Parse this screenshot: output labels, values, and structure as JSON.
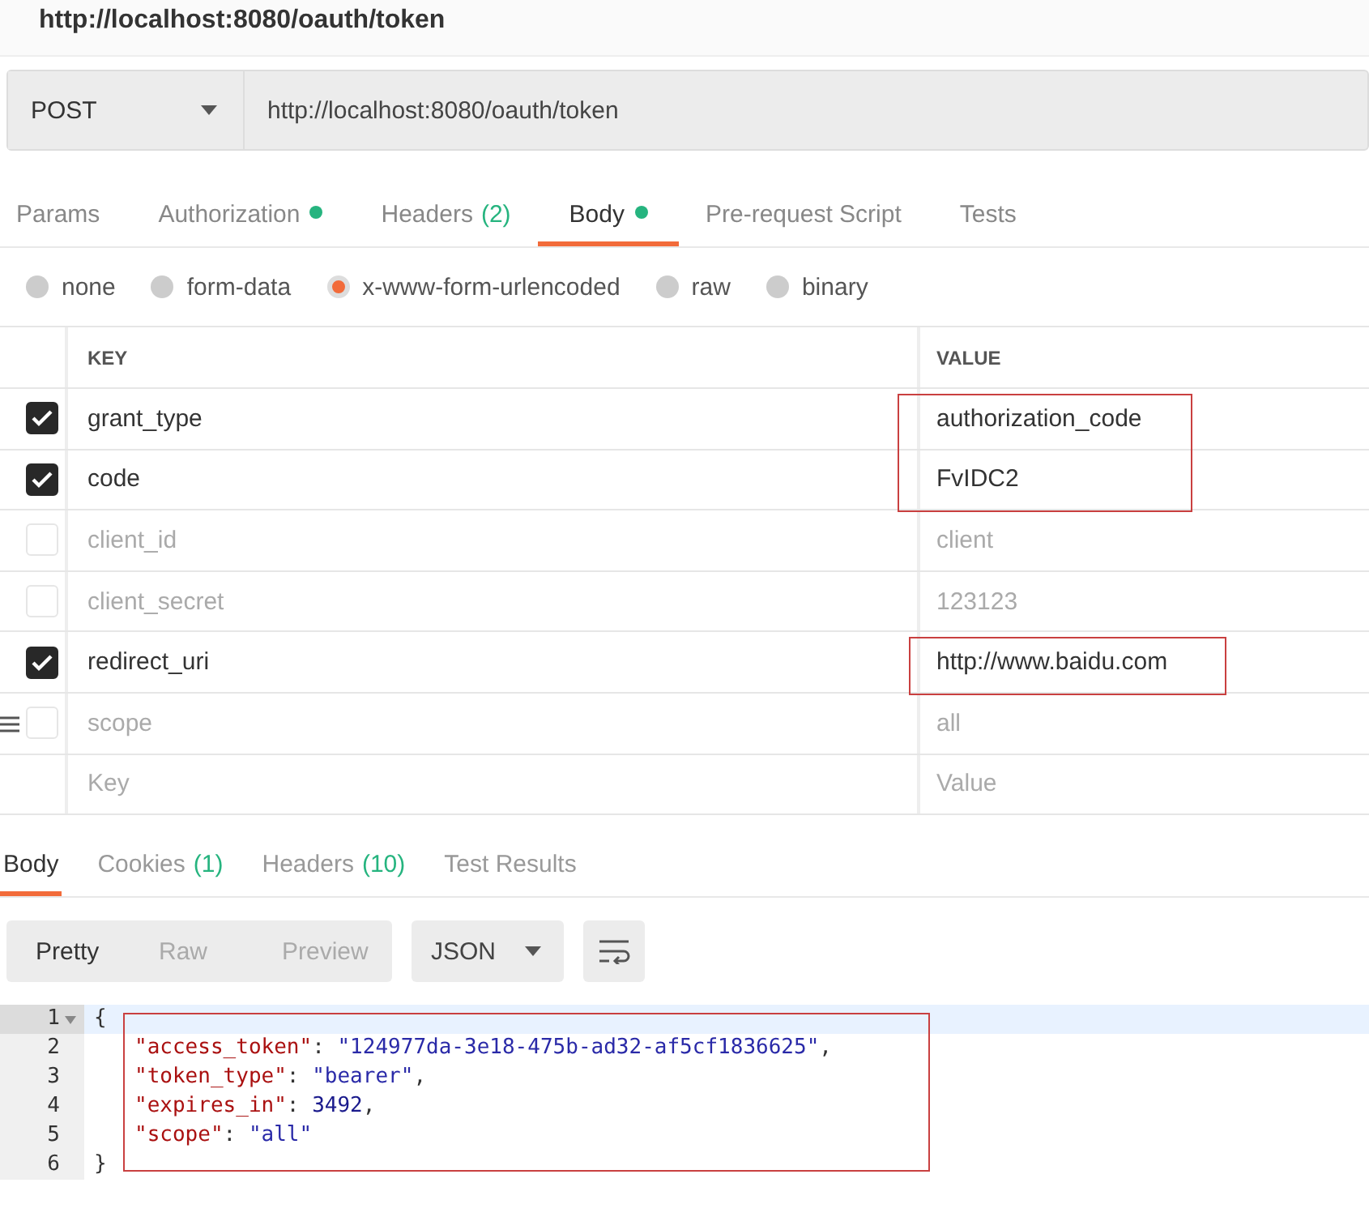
{
  "title": "http://localhost:8080/oauth/token",
  "request": {
    "method": "POST",
    "url": "http://localhost:8080/oauth/token"
  },
  "tabs": [
    {
      "label": "Params",
      "selected": false
    },
    {
      "label": "Authorization",
      "selected": false,
      "dot": true
    },
    {
      "label": "Headers",
      "count": "(2)",
      "selected": false
    },
    {
      "label": "Body",
      "selected": true,
      "dot": true
    },
    {
      "label": "Pre-request Script",
      "selected": false
    },
    {
      "label": "Tests",
      "selected": false
    }
  ],
  "body_types": [
    {
      "label": "none",
      "selected": false
    },
    {
      "label": "form-data",
      "selected": false
    },
    {
      "label": "x-www-form-urlencoded",
      "selected": true
    },
    {
      "label": "raw",
      "selected": false
    },
    {
      "label": "binary",
      "selected": false
    }
  ],
  "table": {
    "columns": [
      "KEY",
      "VALUE"
    ],
    "rows": [
      {
        "key": "grant_type",
        "value": "authorization_code",
        "checked": true,
        "marked": true
      },
      {
        "key": "code",
        "value": "FvIDC2",
        "checked": true,
        "marked": true
      },
      {
        "key": "client_id",
        "value": "client",
        "checked": false,
        "marked": false
      },
      {
        "key": "client_secret",
        "value": "123123",
        "checked": false,
        "marked": false
      },
      {
        "key": "redirect_uri",
        "value": "http://www.baidu.com",
        "checked": true,
        "marked": true
      },
      {
        "key": "scope",
        "value": "all",
        "checked": false,
        "marked": false,
        "handle": true
      }
    ],
    "new_row": {
      "key_placeholder": "Key",
      "value_placeholder": "Value"
    }
  },
  "response_tabs": [
    {
      "label": "Body",
      "selected": true
    },
    {
      "label": "Cookies",
      "count": "(1)",
      "selected": false
    },
    {
      "label": "Headers",
      "count": "(10)",
      "selected": false
    },
    {
      "label": "Test Results",
      "selected": false
    }
  ],
  "view_modes": [
    {
      "label": "Pretty",
      "selected": true
    },
    {
      "label": "Raw",
      "selected": false
    },
    {
      "label": "Preview",
      "selected": false
    }
  ],
  "format": "JSON",
  "code": [
    {
      "number": "1",
      "text": "{",
      "fold": true
    },
    {
      "number": "2",
      "key": "\"access_token\"",
      "sep": ":",
      "value": "\"124977da-3e18-475b-ad32-af5cf1836625\"",
      "kind": "string",
      "tail": ",",
      "marked": true
    },
    {
      "number": "3",
      "key": "\"token_type\"",
      "sep": ":",
      "value": "\"bearer\"",
      "kind": "string",
      "tail": ",",
      "marked": true
    },
    {
      "number": "4",
      "key": "\"expires_in\"",
      "sep": ":",
      "value": "3492",
      "kind": "number",
      "tail": ",",
      "marked": true
    },
    {
      "number": "5",
      "key": "\"scope\"",
      "sep": ":",
      "value": "\"all\"",
      "kind": "string",
      "marked": true
    },
    {
      "number": "6",
      "text": "}"
    }
  ]
}
